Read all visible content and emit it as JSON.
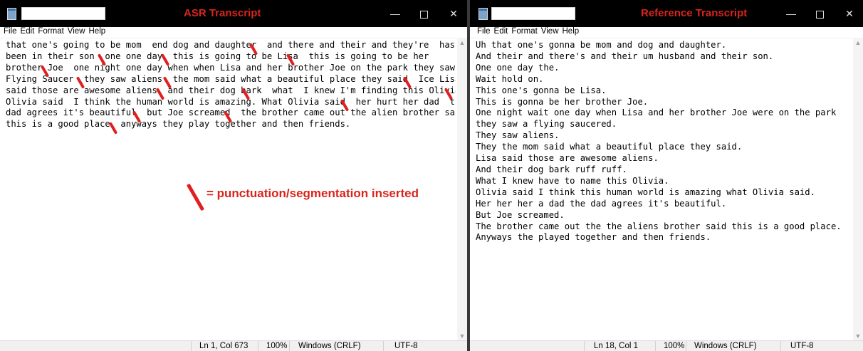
{
  "left": {
    "title": "ASR Transcript",
    "menu": [
      "File",
      "Edit",
      "Format",
      "View",
      "Help"
    ],
    "content": "that one's going to be mom  end dog and daughter  and there and their and they're  has\nbeen in their son  one one day  this is going to be Lisa  this is going to be her\nbrother Joe  one night one day when when Lisa and her brother Joe on the park they saw\nFlying Saucer  they saw aliens  the mom said what a beautiful place they said  Ice Lisa\nsaid those are awesome aliens  and their dog bark  what  I knew I'm finding this Olivia\nOlivia said  I think the human world is amazing. What Olivia said  her hurt her dad  the\ndad agrees it's beautiful  but Joe screamed  the brother came out the alien brother said\nthis is a good place  anyways they play together and then friends.",
    "status": {
      "position": "Ln 1, Col 673",
      "zoom": "100%",
      "line_endings": "Windows (CRLF)",
      "encoding": "UTF-8"
    }
  },
  "right": {
    "title": "Reference Transcript",
    "menu": [
      "File",
      "Edit",
      "Format",
      "View",
      "Help"
    ],
    "content": "Uh that one's gonna be mom and dog and daughter.\nAnd their and there's and their um husband and their son.\nOne one day the.\nWait hold on.\nThis one's gonna be Lisa.\nThis is gonna be her brother Joe.\nOne night wait one day when Lisa and her brother Joe were on the park\nthey saw a flying saucered.\nThey saw aliens.\nThey the mom said what a beautiful place they said.\nLisa said those are awesome aliens.\nAnd their dog bark ruff ruff.\nWhat I knew have to name this Olivia.\nOlivia said I think this human world is amazing what Olivia said.\nHer her her a dad the dad agrees it's beautiful.\nBut Joe screamed.\nThe brother came out the the aliens brother said this is a good place.\nAnyways the played together and then friends.",
    "status": {
      "position": "Ln 18, Col 1",
      "zoom": "100%",
      "line_endings": "Windows (CRLF)",
      "encoding": "UTF-8"
    }
  },
  "annotation": {
    "legend_text": "= punctuation/segmentation inserted",
    "marker_color": "#e02020"
  },
  "icons": {
    "minimize": "—",
    "close": "✕",
    "scroll_up": "▲",
    "scroll_down": "▼"
  }
}
